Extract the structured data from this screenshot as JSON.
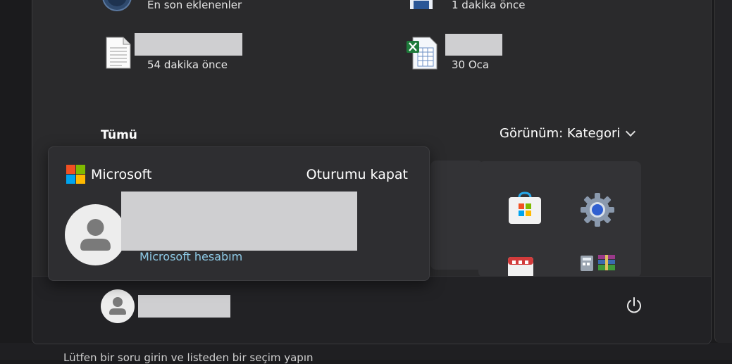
{
  "recent": {
    "items": [
      {
        "label": "En son eklenenler",
        "icon": "clock-icon"
      },
      {
        "label": "1 dakika önce",
        "icon": "word-document-icon"
      },
      {
        "label": "54 dakika önce",
        "icon": "text-document-icon"
      },
      {
        "label": "30 Oca",
        "icon": "excel-spreadsheet-icon"
      }
    ]
  },
  "all_apps": {
    "title": "Tümü",
    "view_toggle": "Görünüm: Kategori",
    "apps": [
      {
        "icon": "microsoft-store-icon"
      },
      {
        "icon": "settings-gear-icon"
      },
      {
        "icon": "calendar-app-icon"
      },
      {
        "icon": "calculator-app-icon"
      },
      {
        "icon": "winrar-app-icon"
      }
    ]
  },
  "account_popup": {
    "brand": "Microsoft",
    "sign_out": "Oturumu kapat",
    "account_link": "Microsoft hesabım"
  },
  "footer": {
    "power_icon": "power-icon",
    "user_icon": "user-avatar-icon"
  },
  "taskbar": {
    "text": "Lütfen bir soru girin ve listeden bir seçim yapın"
  },
  "colors": {
    "ms_red": "#f25022",
    "ms_green": "#7fba00",
    "ms_blue": "#00a4ef",
    "ms_yellow": "#ffb900",
    "link": "#8ecae6"
  }
}
